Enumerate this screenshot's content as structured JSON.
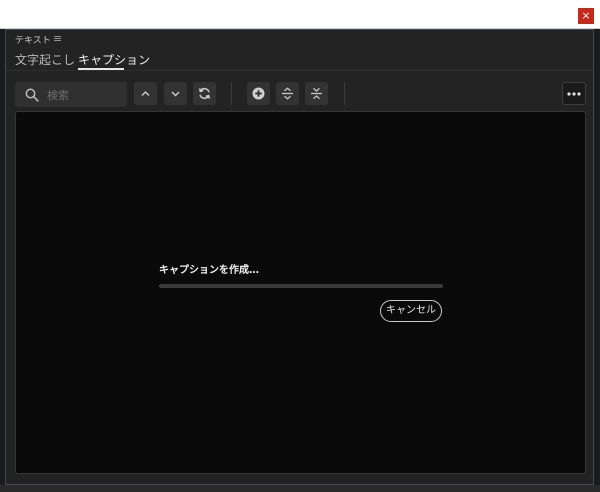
{
  "window": {
    "close_glyph": "×"
  },
  "panel": {
    "title": "テキスト",
    "menu_glyph": "≡"
  },
  "tabs": [
    {
      "label": "文字起こし",
      "active": false
    },
    {
      "label": "キャプション",
      "active": true
    }
  ],
  "search": {
    "placeholder": "検索",
    "value": ""
  },
  "toolbar": {
    "buttons": [
      {
        "name": "previous-button",
        "icon": "chevron-up-icon"
      },
      {
        "name": "next-button",
        "icon": "chevron-down-icon"
      },
      {
        "name": "replace-button",
        "icon": "refresh-icon"
      },
      {
        "name": "add-caption-button",
        "icon": "plus-circle-icon"
      },
      {
        "name": "split-caption-button",
        "icon": "split-icon"
      },
      {
        "name": "merge-caption-button",
        "icon": "merge-icon"
      }
    ],
    "more_glyph": "•••"
  },
  "progress": {
    "label": "キャプションを作成…",
    "percent": 0,
    "cancel_label": "キャンセル"
  },
  "colors": {
    "close": "#c42b1c",
    "panel_bg": "#232323",
    "content_bg": "#0a0a0a"
  }
}
